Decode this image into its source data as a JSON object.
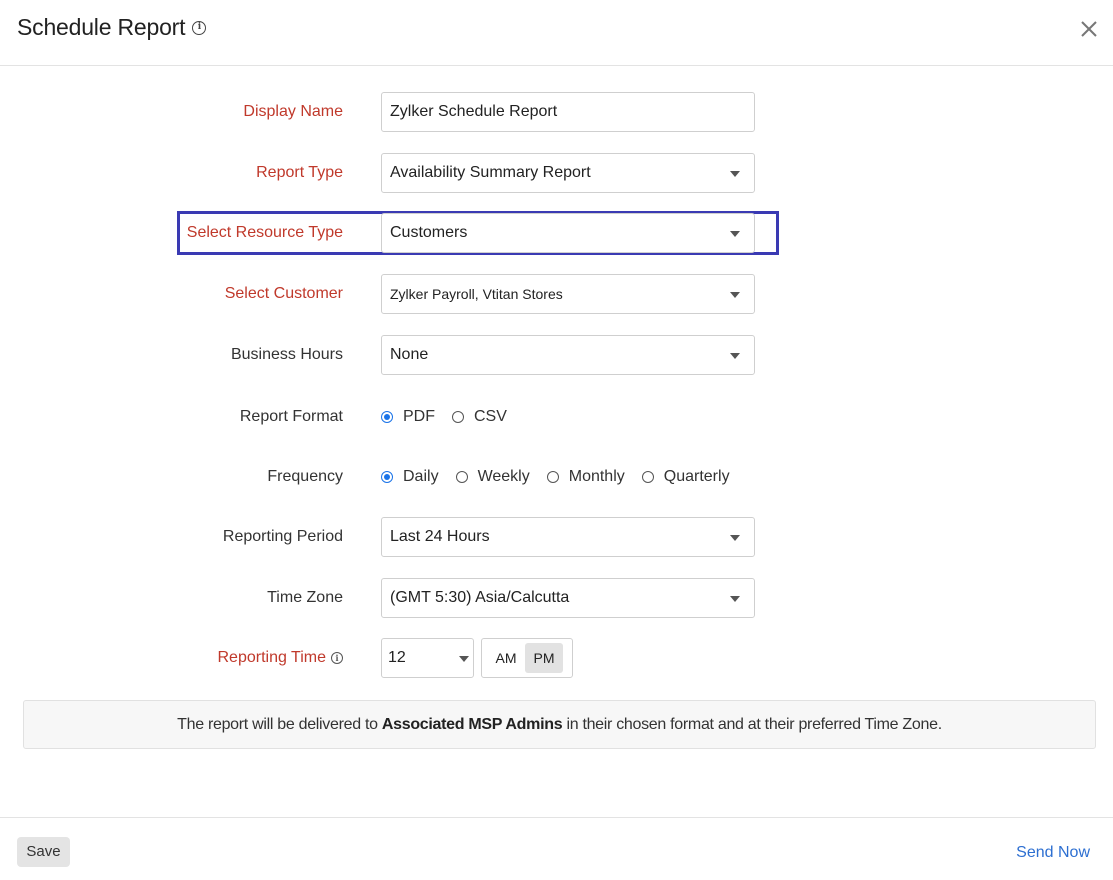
{
  "header": {
    "title": "Schedule Report",
    "info_icon": "i"
  },
  "form": {
    "display_name": {
      "label": "Display Name",
      "value": "Zylker Schedule Report"
    },
    "report_type": {
      "label": "Report Type",
      "value": "Availability Summary Report"
    },
    "resource_type": {
      "label": "Select Resource Type",
      "value": "Customers"
    },
    "customer": {
      "label": "Select Customer",
      "value": "Zylker Payroll, Vtitan Stores"
    },
    "business_hours": {
      "label": "Business Hours",
      "value": "None"
    },
    "report_format": {
      "label": "Report Format",
      "options": [
        "PDF",
        "CSV"
      ],
      "selected": "PDF"
    },
    "frequency": {
      "label": "Frequency",
      "options": [
        "Daily",
        "Weekly",
        "Monthly",
        "Quarterly"
      ],
      "selected": "Daily"
    },
    "reporting_period": {
      "label": "Reporting Period",
      "value": "Last 24 Hours"
    },
    "time_zone": {
      "label": "Time Zone",
      "value": "(GMT 5:30) Asia/Calcutta"
    },
    "reporting_time": {
      "label": "Reporting Time",
      "hour": "12",
      "am": "AM",
      "pm": "PM",
      "selected": "PM"
    }
  },
  "notice": {
    "prefix": "The report will be delivered to ",
    "bold": "Associated MSP Admins",
    "suffix": " in their chosen format and at their preferred Time Zone."
  },
  "footer": {
    "save_label": "Save",
    "send_now_label": "Send Now"
  },
  "colors": {
    "required_label": "#c0392b",
    "highlight_border": "#3a3ab3",
    "radio_selected": "#1a73e8",
    "link": "#2d6fd1"
  }
}
